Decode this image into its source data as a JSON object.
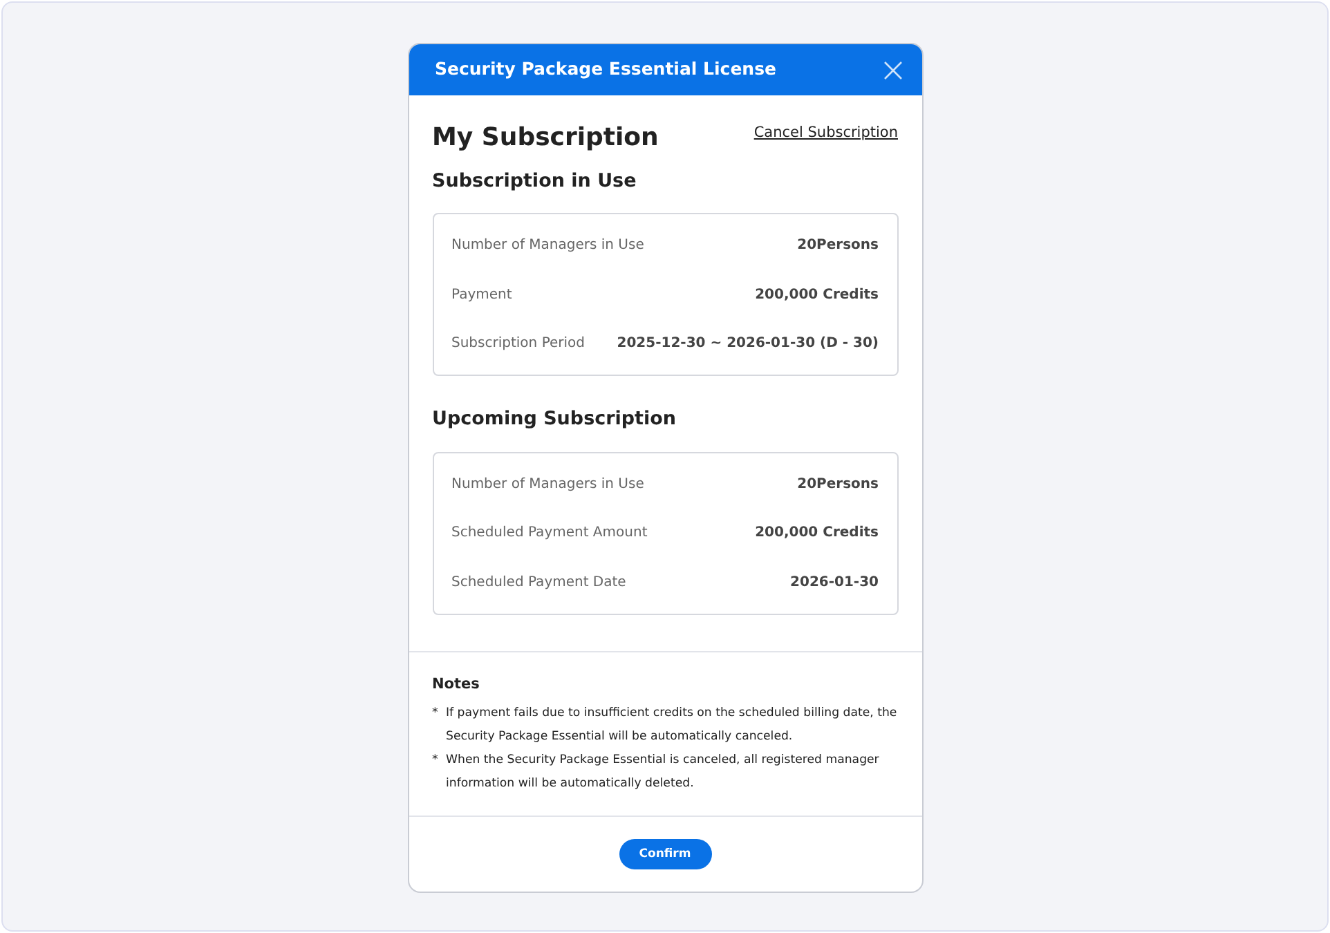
{
  "dialog": {
    "title": "Security Package Essential License"
  },
  "heading": "My Subscription",
  "cancel_link": "Cancel Subscription",
  "sections": [
    {
      "title": "Subscription in Use",
      "rows": [
        {
          "label": "Number of Managers in Use",
          "value": "20Persons"
        },
        {
          "label": "Payment",
          "value": "200,000 Credits"
        },
        {
          "label": "Subscription Period",
          "value": "2025-12-30 ~ 2026-01-30 (D - 30)"
        }
      ]
    },
    {
      "title": "Upcoming Subscription",
      "rows": [
        {
          "label": "Number of Managers in Use",
          "value": "20Persons"
        },
        {
          "label": "Scheduled Payment Amount",
          "value": "200,000 Credits"
        },
        {
          "label": "Scheduled Payment Date",
          "value": "2026-01-30"
        }
      ]
    }
  ],
  "notes": {
    "title": "Notes",
    "items": [
      {
        "marker": "*",
        "text": "If payment fails due to insufficient credits on the scheduled billing date, the Security Package Essential will be automatically canceled."
      },
      {
        "marker": "*",
        "text": "When the Security Package Essential is canceled, all registered manager information will be automatically deleted."
      }
    ]
  },
  "buttons": [
    "Confirm"
  ]
}
